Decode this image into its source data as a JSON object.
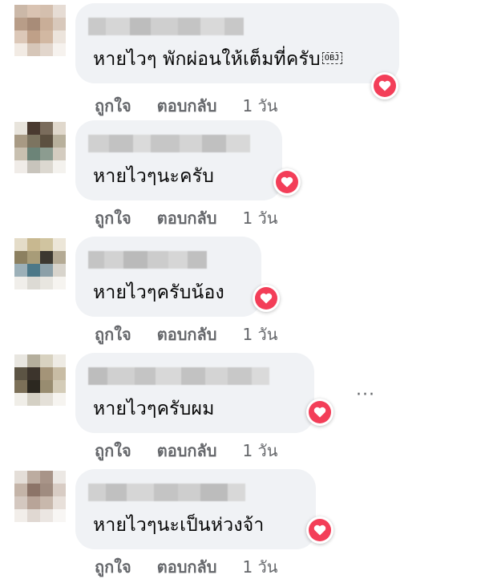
{
  "comments": [
    {
      "text": "หายไวๆ พักผ่อนให้เต็มที่ครับ",
      "emoji_placeholder": "OBJ",
      "like_label": "ถูกใจ",
      "reply_label": "ตอบกลับ",
      "time": "1 วัน",
      "reaction": "heart-icon"
    },
    {
      "text": "หายไวๆนะครับ",
      "like_label": "ถูกใจ",
      "reply_label": "ตอบกลับ",
      "time": "1 วัน",
      "reaction": "heart-icon"
    },
    {
      "text": "หายไวๆครับน้อง",
      "like_label": "ถูกใจ",
      "reply_label": "ตอบกลับ",
      "time": "1 วัน",
      "reaction": "heart-icon"
    },
    {
      "text": "หายไวๆครับผม",
      "like_label": "ถูกใจ",
      "reply_label": "ตอบกลับ",
      "time": "1 วัน",
      "reaction": "heart-icon",
      "more_label": "···"
    },
    {
      "text": "หายไวๆนะเป็นห่วงจ้า",
      "like_label": "ถูกใจ",
      "reply_label": "ตอบกลับ",
      "time": "1 วัน",
      "reaction": "heart-icon"
    }
  ],
  "colors": {
    "bubble": "#f0f2f5",
    "heart": "#f33e58",
    "meta_text": "#65676b"
  }
}
